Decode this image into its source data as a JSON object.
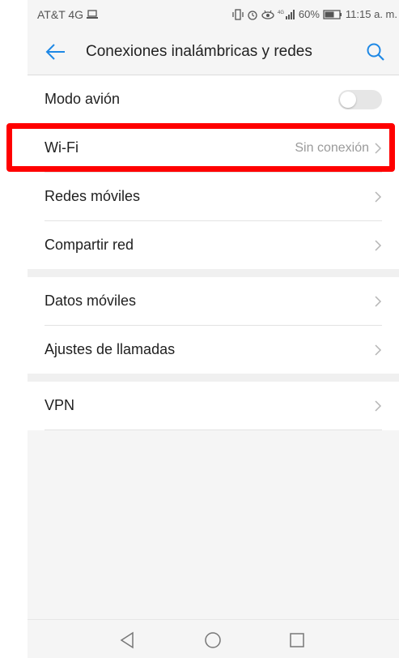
{
  "status_bar": {
    "carrier": "AT&T 4G",
    "battery": "60%",
    "time": "11:15 a. m.",
    "icons": [
      "laptop-icon",
      "vibrate-icon",
      "alarm-icon",
      "eye-icon",
      "signal-4g-icon",
      "battery-icon"
    ]
  },
  "app_bar": {
    "title": "Conexiones inalámbricas y redes",
    "back_icon": "back-arrow-icon",
    "search_icon": "search-icon"
  },
  "groups": [
    {
      "items": [
        {
          "label": "Modo avión",
          "control": "toggle",
          "toggle_on": false
        },
        {
          "label": "Wi-Fi",
          "value": "Sin conexión",
          "control": "chevron"
        },
        {
          "label": "Redes móviles",
          "control": "chevron"
        },
        {
          "label": "Compartir red",
          "control": "chevron"
        }
      ]
    },
    {
      "items": [
        {
          "label": "Datos móviles",
          "control": "chevron"
        },
        {
          "label": "Ajustes de llamadas",
          "control": "chevron"
        }
      ]
    },
    {
      "items": [
        {
          "label": "VPN",
          "control": "chevron"
        }
      ]
    }
  ],
  "nav_bar": {
    "buttons": [
      "back-triangle-icon",
      "home-circle-icon",
      "recents-square-icon"
    ]
  },
  "colors": {
    "accent": "#1e88e5",
    "highlight": "#ff0000"
  }
}
